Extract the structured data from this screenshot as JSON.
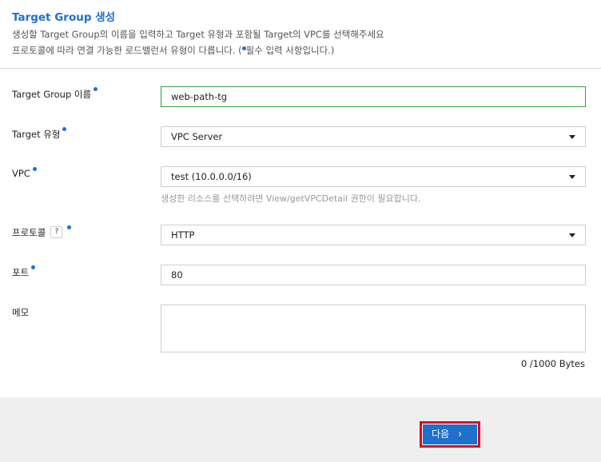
{
  "header": {
    "title": "Target Group 생성",
    "desc_line1": "생성할 Target Group의 이름을 입력하고 Target 유형과 포함될 Target의 VPC를 선택해주세요",
    "desc_line2_prefix": "프로토콜에 따라 연결 가능한 로드밸런서 유형이 다릅니다. (",
    "desc_line2_suffix": "필수 입력 사항입니다.)"
  },
  "form": {
    "name_label": "Target Group 이름",
    "name_value": "web-path-tg",
    "type_label": "Target 유형",
    "type_value": "VPC Server",
    "vpc_label": "VPC",
    "vpc_value": "test (10.0.0.0/16)",
    "vpc_hint": "생성한 리소스를 선택하려면 View/getVPCDetail 권한이 필요합니다.",
    "protocol_label": "프로토콜",
    "protocol_help": "?",
    "protocol_value": "HTTP",
    "port_label": "포트",
    "port_value": "80",
    "memo_label": "메모",
    "memo_value": "",
    "memo_counter": "0 /1000 Bytes"
  },
  "footer": {
    "next_label": "다음",
    "next_chevron": "›"
  },
  "colors": {
    "accent": "#1f6fcf",
    "highlight": "#e0001b",
    "focus": "#2ea043"
  }
}
